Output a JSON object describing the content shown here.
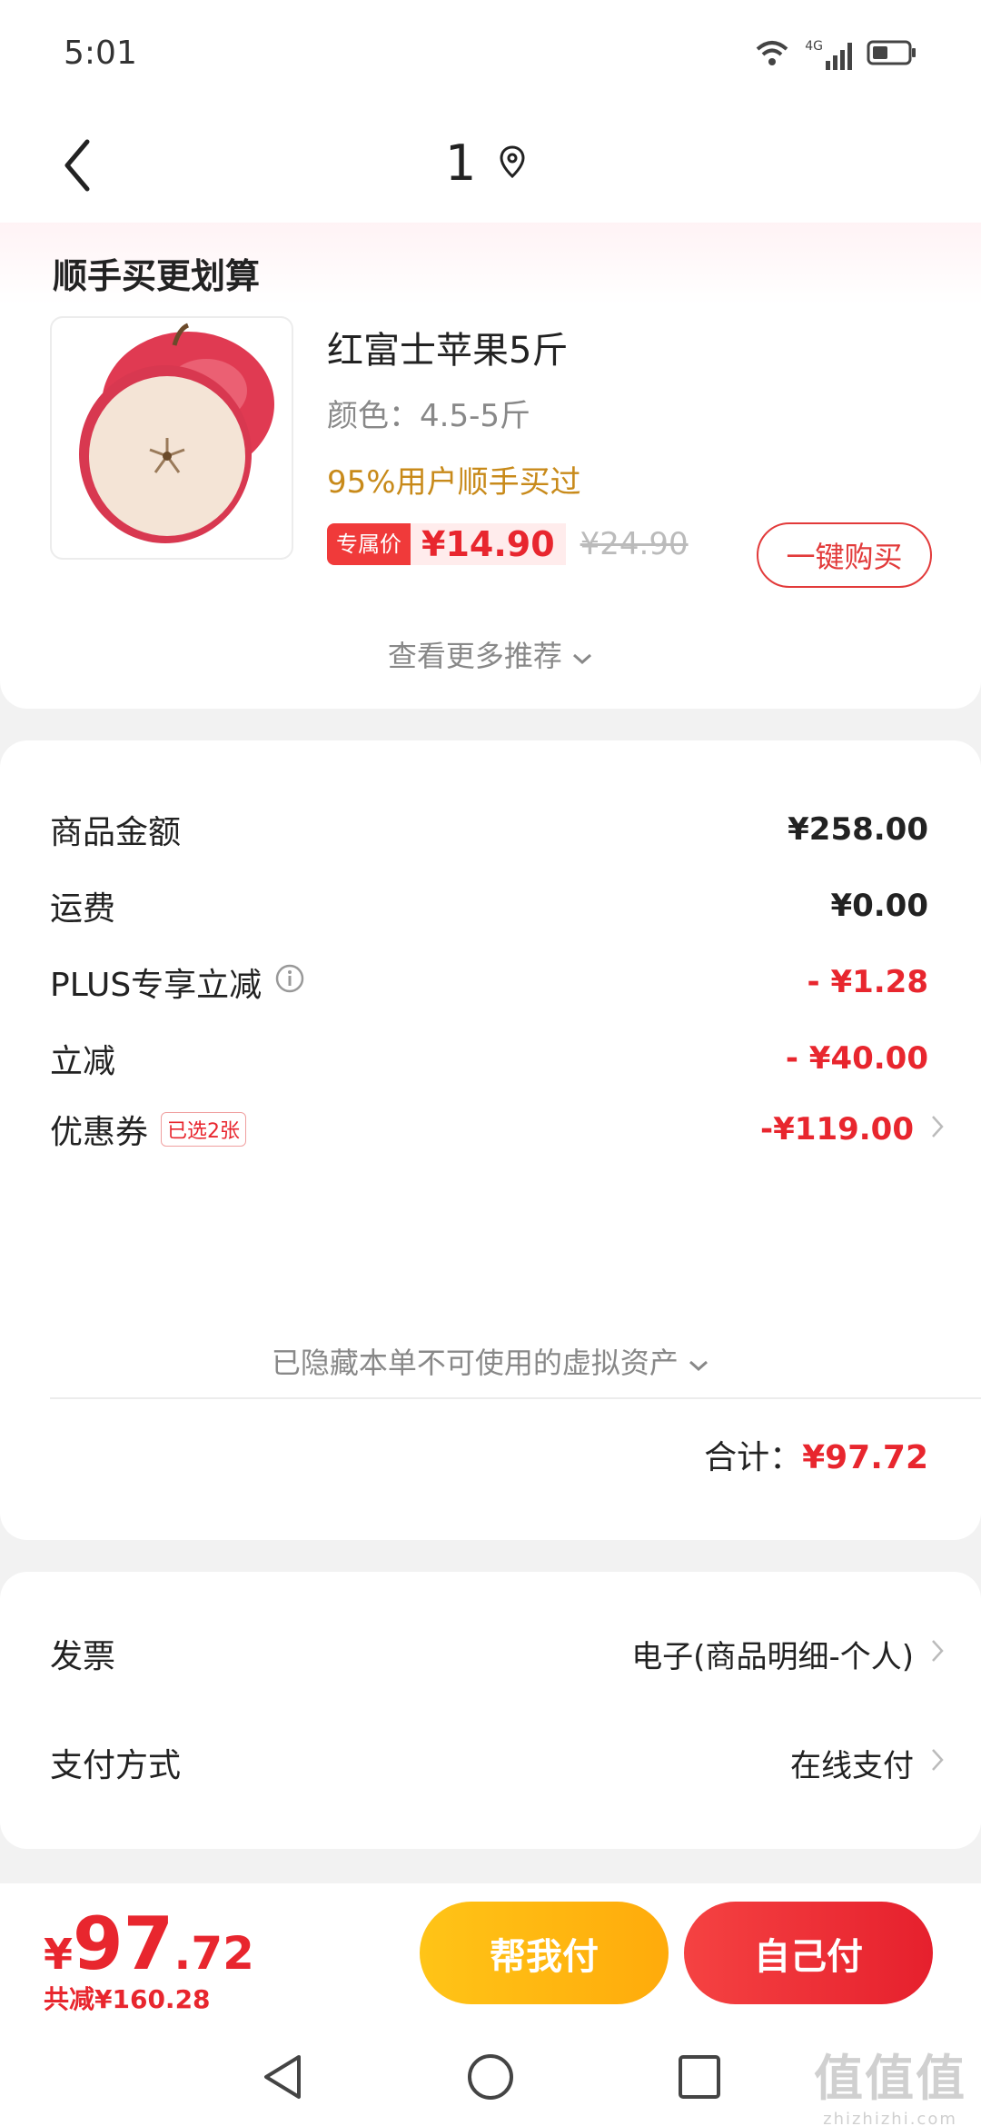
{
  "status_bar": {
    "time": "5:01",
    "network": "4G"
  },
  "nav": {
    "title": "1"
  },
  "recommend": {
    "heading": "顺手买更划算",
    "product": {
      "name": "红富士苹果5斤",
      "spec": "颜色：4.5-5斤",
      "social_proof": "95%用户顺手买过",
      "exclusive_label": "专属价",
      "exclusive_price": "¥14.90",
      "original_price": "¥24.90",
      "buy_label": "一键购买"
    },
    "more_label": "查看更多推荐"
  },
  "amounts": {
    "goods_label": "商品金额",
    "goods_value": "¥258.00",
    "shipping_label": "运费",
    "shipping_value": "¥0.00",
    "plus_label": "PLUS专享立减",
    "plus_value": "- ¥1.28",
    "discount_label": "立减",
    "discount_value": "- ¥40.00",
    "coupon_label": "优惠券",
    "coupon_tag": "已选2张",
    "coupon_value": "-¥119.00",
    "hidden_note": "已隐藏本单不可使用的虚拟资产",
    "total_label": "合计：",
    "total_value": "¥97.72"
  },
  "payment": {
    "invoice_label": "发票",
    "invoice_value": "电子(商品明细-个人)",
    "method_label": "支付方式",
    "method_value": "在线支付"
  },
  "bottom": {
    "currency": "¥",
    "total_int": "97",
    "total_dec": ".72",
    "saved": "共减¥160.28",
    "help_pay": "帮我付",
    "self_pay": "自己付"
  },
  "watermark": {
    "big": "值值值",
    "small": "zhizhizhi.com"
  },
  "colors": {
    "accent_red": "#e8262e",
    "help_yellow": "#ffb811",
    "social_gold": "#c88a1a"
  }
}
